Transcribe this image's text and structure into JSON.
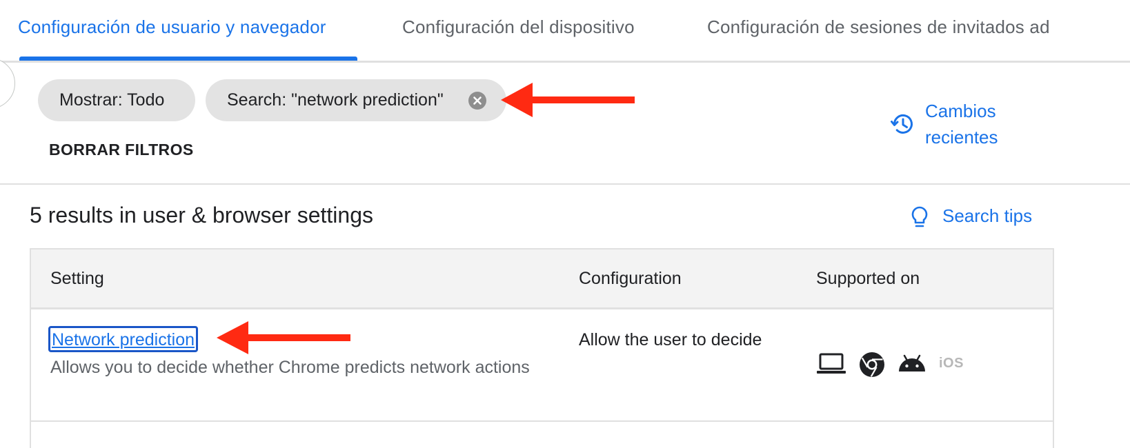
{
  "tabs": [
    {
      "label": "Configuración de usuario y navegador",
      "active": true
    },
    {
      "label": "Configuración del dispositivo",
      "active": false
    },
    {
      "label": "Configuración de sesiones de invitados ad",
      "active": false
    }
  ],
  "filters": {
    "chips": [
      {
        "label": "Mostrar: Todo"
      },
      {
        "label": "Search: \"network prediction\"",
        "removable": true
      }
    ],
    "clear_label": "BORRAR FILTROS"
  },
  "recent_changes": {
    "label": "Cambios recientes",
    "icon": "history-icon"
  },
  "results": {
    "title": "5 results in user & browser settings"
  },
  "search_tips": {
    "label": "Search tips",
    "icon": "lightbulb-icon"
  },
  "table": {
    "headers": [
      "Setting",
      "Configuration",
      "Supported on"
    ],
    "rows": [
      {
        "setting": "Network prediction",
        "description": "Allows you to decide whether Chrome predicts network actions",
        "configuration": "Allow the user to decide",
        "platforms": [
          "laptop-icon",
          "chrome-icon",
          "android-icon",
          "iOS"
        ]
      }
    ]
  },
  "colors": {
    "accent": "#1a73e8",
    "annotation_arrow": "#ff2a12"
  }
}
